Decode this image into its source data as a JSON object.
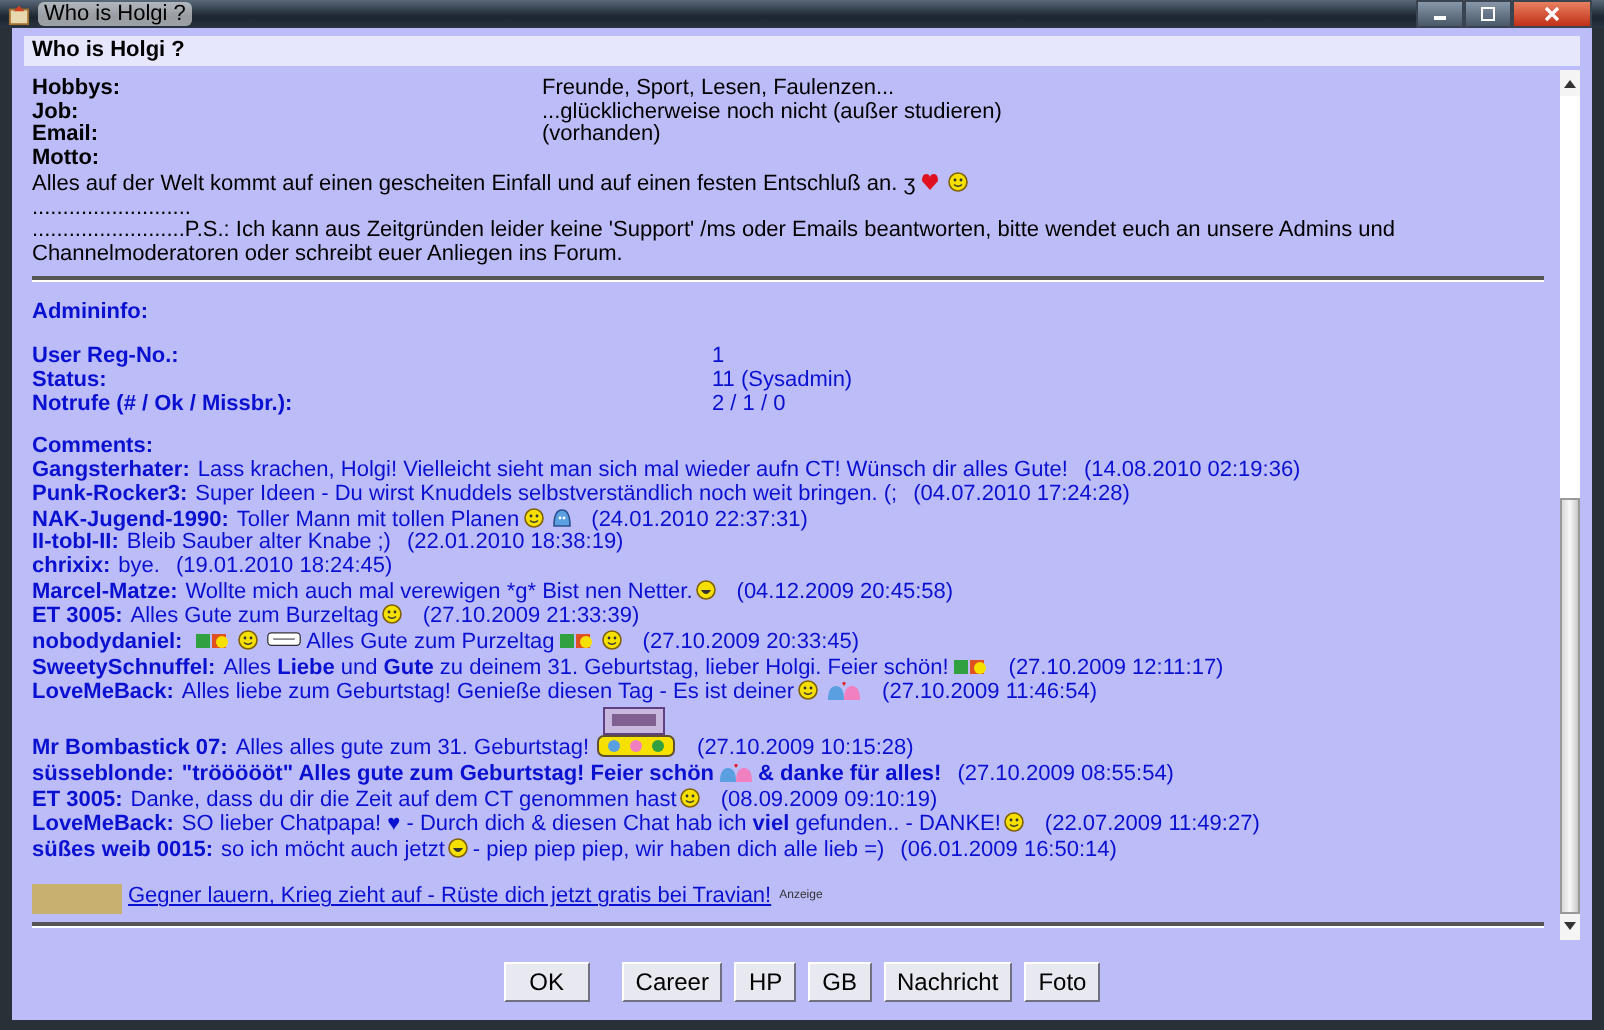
{
  "window": {
    "title": "Who is Holgi ?"
  },
  "header": {
    "title": "Who is Holgi ?"
  },
  "profile": [
    {
      "label": "Hobbys:",
      "value": "Freunde, Sport, Lesen, Faulenzen..."
    },
    {
      "label": "Job:",
      "value": "...glücklicherweise noch nicht (außer studieren)"
    },
    {
      "label": "Email:",
      "value": "(vorhanden)"
    },
    {
      "label": "Motto:"
    }
  ],
  "motto": {
    "text": "Alles auf der Welt kommt auf einen gescheiten Einfall und auf einen festen Entschluß an. ʒ",
    "emoticons": [
      {
        "kind": "heart"
      },
      {
        "kind": "smiley"
      }
    ]
  },
  "notes": [
    "..........................",
    ".........................P.S.: Ich kann aus Zeitgründen leider keine 'Support' /ms oder Emails beantworten, bitte wendet euch an unsere Admins und Channelmoderatoren oder schreibt euer Anliegen ins Forum."
  ],
  "admininfo": {
    "heading": "Admininfo:",
    "rows": [
      {
        "label": "User Reg-No.:",
        "value": "1"
      },
      {
        "label": "Status:",
        "value": "11 (Sysadmin)"
      },
      {
        "label": "Notrufe (# / Ok / Missbr.):",
        "value": "2 / 1 / 0"
      }
    ]
  },
  "comments": {
    "heading": "Comments:",
    "items": [
      {
        "author": "Gangsterhater:",
        "message": "Lass krachen, Holgi! Vielleicht sieht man sich mal wieder aufn CT! Wünsch dir alles Gute!",
        "time": "(14.08.2010 02:19:36)",
        "bold": false
      },
      {
        "author": "Punk-Rocker3:",
        "message": "Super Ideen - Du wirst Knuddels selbstverständlich noch weit bringen. (;",
        "time": "(04.07.2010 17:24:28)",
        "bold": false
      },
      {
        "author": "NAK-Jugend-1990:",
        "message": "Toller Mann mit tollen Planen",
        "emoticons": [
          {
            "kind": "smiley"
          },
          {
            "kind": "blob"
          }
        ],
        "time": "(24.01.2010 22:37:31)",
        "bold": false
      },
      {
        "author": "II-tobI-II:",
        "message": "Bleib Sauber alter Knabe ;)",
        "time": "(22.01.2010 18:38:19)",
        "bold": false
      },
      {
        "author": "chrixix:",
        "message": "bye.",
        "time": "(19.01.2010 18:24:45)",
        "bold": false
      },
      {
        "author": "Marcel-Matze:",
        "message": "Wollte mich auch mal verewigen *g* Bist nen Netter.",
        "emoticons": [
          {
            "kind": "laugh"
          }
        ],
        "time": "(04.12.2009 20:45:58)",
        "bold": false
      },
      {
        "author": "ET 3005:",
        "message": "Alles Gute zum Burzeltag",
        "emoticons": [
          {
            "kind": "smiley"
          }
        ],
        "time": "(27.10.2009 21:33:39)",
        "bold": false
      },
      {
        "author": "nobodydaniel:",
        "emoticons_before": [
          {
            "kind": "sticker"
          },
          {
            "kind": "smiley"
          },
          {
            "kind": "sign"
          }
        ],
        "message": "Alles Gute zum Purzeltag",
        "emoticons": [
          {
            "kind": "sticker"
          },
          {
            "kind": "smiley"
          }
        ],
        "time": "(27.10.2009 20:33:45)",
        "bold": false
      },
      {
        "author": "SweetySchnuffel:",
        "message_rich": "Alles **Liebe** und **Gute** zu deinem 31. Geburtstag, lieber Holgi. Feier schön!",
        "emoticons": [
          {
            "kind": "sticker"
          }
        ],
        "time": "(27.10.2009 12:11:17)",
        "bold": false
      },
      {
        "author": "LoveMeBack:",
        "message": "Alles liebe zum Geburtstag! Genieße diesen Tag - Es ist deiner",
        "emoticons": [
          {
            "kind": "smiley"
          },
          {
            "kind": "couple"
          }
        ],
        "time": "(27.10.2009 11:46:54)",
        "bold": false
      },
      {
        "author": "Mr Bombastick 07:",
        "message": "Alles alles gute zum 31. Geburtstag!",
        "emoticons": [
          {
            "kind": "banner"
          }
        ],
        "time": "(27.10.2009 10:15:28)",
        "bold": false
      },
      {
        "author": "süsseblonde:",
        "message": "\"tröööööt\" Alles gute zum Geburtstag! Feier schön",
        "emoticons": [
          {
            "kind": "couple"
          }
        ],
        "message_after": "& danke für alles!",
        "time": "(27.10.2009 08:55:54)",
        "bold": true
      },
      {
        "author": "ET 3005:",
        "message": "Danke, dass du dir die Zeit auf dem CT genommen hast",
        "emoticons": [
          {
            "kind": "smiley"
          }
        ],
        "time": "(08.09.2009 09:10:19)",
        "bold": false
      },
      {
        "author": "LoveMeBack:",
        "message_rich": "SO lieber Chatpapa! ♥ - Durch dich & diesen Chat hab ich **viel** gefunden.. - DANKE!",
        "emoticons": [
          {
            "kind": "smiley"
          }
        ],
        "time": "(22.07.2009 11:49:27)",
        "bold": false
      },
      {
        "author": "süßes weib 0015:",
        "message": "so ich möcht auch jetzt",
        "emoticons": [
          {
            "kind": "laugh"
          }
        ],
        "message_after": "- piep piep piep, wir haben dich alle lieb =)",
        "time": "(06.01.2009 16:50:14)",
        "bold": false
      }
    ]
  },
  "ad": {
    "link": "Gegner lauern, Krieg zieht auf - Rüste dich jetzt gratis bei Travian!",
    "tag": "Anzeige"
  },
  "buttons": [
    "OK",
    "Career",
    "HP",
    "GB",
    "Nachricht",
    "Foto"
  ]
}
